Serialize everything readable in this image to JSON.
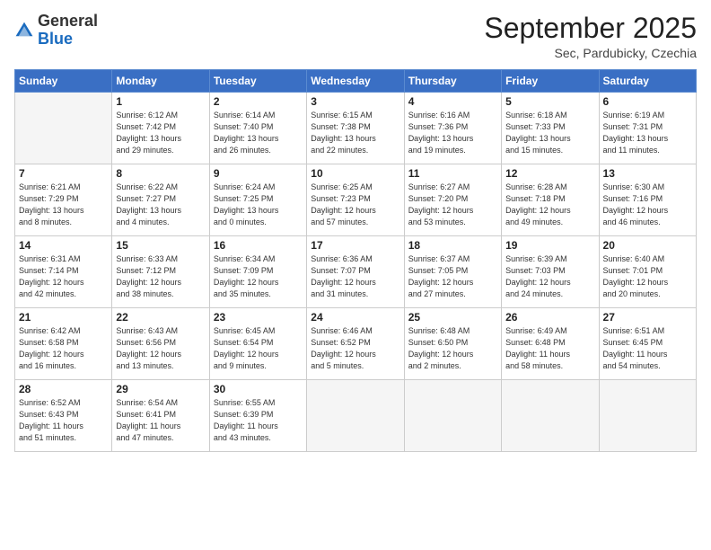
{
  "logo": {
    "general": "General",
    "blue": "Blue"
  },
  "header": {
    "month": "September 2025",
    "location": "Sec, Pardubicky, Czechia"
  },
  "weekdays": [
    "Sunday",
    "Monday",
    "Tuesday",
    "Wednesday",
    "Thursday",
    "Friday",
    "Saturday"
  ],
  "weeks": [
    [
      {
        "day": "",
        "info": ""
      },
      {
        "day": "1",
        "info": "Sunrise: 6:12 AM\nSunset: 7:42 PM\nDaylight: 13 hours\nand 29 minutes."
      },
      {
        "day": "2",
        "info": "Sunrise: 6:14 AM\nSunset: 7:40 PM\nDaylight: 13 hours\nand 26 minutes."
      },
      {
        "day": "3",
        "info": "Sunrise: 6:15 AM\nSunset: 7:38 PM\nDaylight: 13 hours\nand 22 minutes."
      },
      {
        "day": "4",
        "info": "Sunrise: 6:16 AM\nSunset: 7:36 PM\nDaylight: 13 hours\nand 19 minutes."
      },
      {
        "day": "5",
        "info": "Sunrise: 6:18 AM\nSunset: 7:33 PM\nDaylight: 13 hours\nand 15 minutes."
      },
      {
        "day": "6",
        "info": "Sunrise: 6:19 AM\nSunset: 7:31 PM\nDaylight: 13 hours\nand 11 minutes."
      }
    ],
    [
      {
        "day": "7",
        "info": "Sunrise: 6:21 AM\nSunset: 7:29 PM\nDaylight: 13 hours\nand 8 minutes."
      },
      {
        "day": "8",
        "info": "Sunrise: 6:22 AM\nSunset: 7:27 PM\nDaylight: 13 hours\nand 4 minutes."
      },
      {
        "day": "9",
        "info": "Sunrise: 6:24 AM\nSunset: 7:25 PM\nDaylight: 13 hours\nand 0 minutes."
      },
      {
        "day": "10",
        "info": "Sunrise: 6:25 AM\nSunset: 7:23 PM\nDaylight: 12 hours\nand 57 minutes."
      },
      {
        "day": "11",
        "info": "Sunrise: 6:27 AM\nSunset: 7:20 PM\nDaylight: 12 hours\nand 53 minutes."
      },
      {
        "day": "12",
        "info": "Sunrise: 6:28 AM\nSunset: 7:18 PM\nDaylight: 12 hours\nand 49 minutes."
      },
      {
        "day": "13",
        "info": "Sunrise: 6:30 AM\nSunset: 7:16 PM\nDaylight: 12 hours\nand 46 minutes."
      }
    ],
    [
      {
        "day": "14",
        "info": "Sunrise: 6:31 AM\nSunset: 7:14 PM\nDaylight: 12 hours\nand 42 minutes."
      },
      {
        "day": "15",
        "info": "Sunrise: 6:33 AM\nSunset: 7:12 PM\nDaylight: 12 hours\nand 38 minutes."
      },
      {
        "day": "16",
        "info": "Sunrise: 6:34 AM\nSunset: 7:09 PM\nDaylight: 12 hours\nand 35 minutes."
      },
      {
        "day": "17",
        "info": "Sunrise: 6:36 AM\nSunset: 7:07 PM\nDaylight: 12 hours\nand 31 minutes."
      },
      {
        "day": "18",
        "info": "Sunrise: 6:37 AM\nSunset: 7:05 PM\nDaylight: 12 hours\nand 27 minutes."
      },
      {
        "day": "19",
        "info": "Sunrise: 6:39 AM\nSunset: 7:03 PM\nDaylight: 12 hours\nand 24 minutes."
      },
      {
        "day": "20",
        "info": "Sunrise: 6:40 AM\nSunset: 7:01 PM\nDaylight: 12 hours\nand 20 minutes."
      }
    ],
    [
      {
        "day": "21",
        "info": "Sunrise: 6:42 AM\nSunset: 6:58 PM\nDaylight: 12 hours\nand 16 minutes."
      },
      {
        "day": "22",
        "info": "Sunrise: 6:43 AM\nSunset: 6:56 PM\nDaylight: 12 hours\nand 13 minutes."
      },
      {
        "day": "23",
        "info": "Sunrise: 6:45 AM\nSunset: 6:54 PM\nDaylight: 12 hours\nand 9 minutes."
      },
      {
        "day": "24",
        "info": "Sunrise: 6:46 AM\nSunset: 6:52 PM\nDaylight: 12 hours\nand 5 minutes."
      },
      {
        "day": "25",
        "info": "Sunrise: 6:48 AM\nSunset: 6:50 PM\nDaylight: 12 hours\nand 2 minutes."
      },
      {
        "day": "26",
        "info": "Sunrise: 6:49 AM\nSunset: 6:48 PM\nDaylight: 11 hours\nand 58 minutes."
      },
      {
        "day": "27",
        "info": "Sunrise: 6:51 AM\nSunset: 6:45 PM\nDaylight: 11 hours\nand 54 minutes."
      }
    ],
    [
      {
        "day": "28",
        "info": "Sunrise: 6:52 AM\nSunset: 6:43 PM\nDaylight: 11 hours\nand 51 minutes."
      },
      {
        "day": "29",
        "info": "Sunrise: 6:54 AM\nSunset: 6:41 PM\nDaylight: 11 hours\nand 47 minutes."
      },
      {
        "day": "30",
        "info": "Sunrise: 6:55 AM\nSunset: 6:39 PM\nDaylight: 11 hours\nand 43 minutes."
      },
      {
        "day": "",
        "info": ""
      },
      {
        "day": "",
        "info": ""
      },
      {
        "day": "",
        "info": ""
      },
      {
        "day": "",
        "info": ""
      }
    ]
  ]
}
